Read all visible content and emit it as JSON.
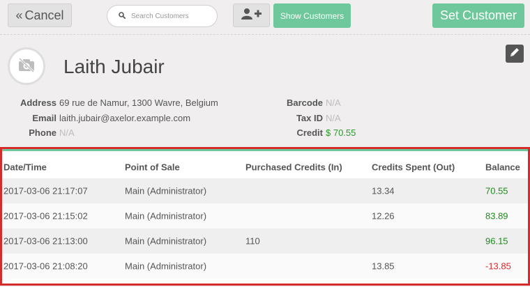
{
  "toolbar": {
    "cancel_label": "Cancel",
    "cancel_icon": "chevrons-left-icon",
    "search_placeholder": "Search Customers",
    "search_value": "",
    "add_customer_icon": "user-plus-icon",
    "show_customers_label": "Show Customers",
    "set_customer_label": "Set Customer"
  },
  "customer": {
    "name": "Laith Jubair",
    "avatar_icon": "no-camera-icon",
    "edit_icon": "pencil-icon",
    "details_left": [
      {
        "label": "Address",
        "value": "69 rue de Namur, 1300 Wavre, Belgium",
        "style": "normal"
      },
      {
        "label": "Email",
        "value": "laith.jubair@axelor.example.com",
        "style": "normal"
      },
      {
        "label": "Phone",
        "value": "N/A",
        "style": "na"
      }
    ],
    "details_right": [
      {
        "label": "Barcode",
        "value": "N/A",
        "style": "na"
      },
      {
        "label": "Tax ID",
        "value": "N/A",
        "style": "na"
      },
      {
        "label": "Credit",
        "value": "$ 70.55",
        "style": "credit"
      }
    ]
  },
  "history": {
    "columns": [
      "Date/Time",
      "Point of Sale",
      "Purchased Credits (In)",
      "Credits Spent (Out)",
      "Balance"
    ],
    "rows": [
      {
        "datetime": "2017-03-06 21:17:07",
        "pos": "Main (Administrator)",
        "in": "",
        "out": "13.34",
        "balance": "70.55",
        "balance_sign": "positive"
      },
      {
        "datetime": "2017-03-06 21:15:02",
        "pos": "Main (Administrator)",
        "in": "",
        "out": "12.26",
        "balance": "83.89",
        "balance_sign": "positive"
      },
      {
        "datetime": "2017-03-06 21:13:00",
        "pos": "Main (Administrator)",
        "in": "110",
        "out": "",
        "balance": "96.15",
        "balance_sign": "positive"
      },
      {
        "datetime": "2017-03-06 21:08:20",
        "pos": "Main (Administrator)",
        "in": "",
        "out": "13.85",
        "balance": "-13.85",
        "balance_sign": "negative"
      }
    ]
  },
  "colors": {
    "accent_green": "#6ec89b",
    "positive_balance": "#1e8a1e",
    "negative_balance": "#e0262a",
    "highlight_border": "#d52b2b"
  }
}
